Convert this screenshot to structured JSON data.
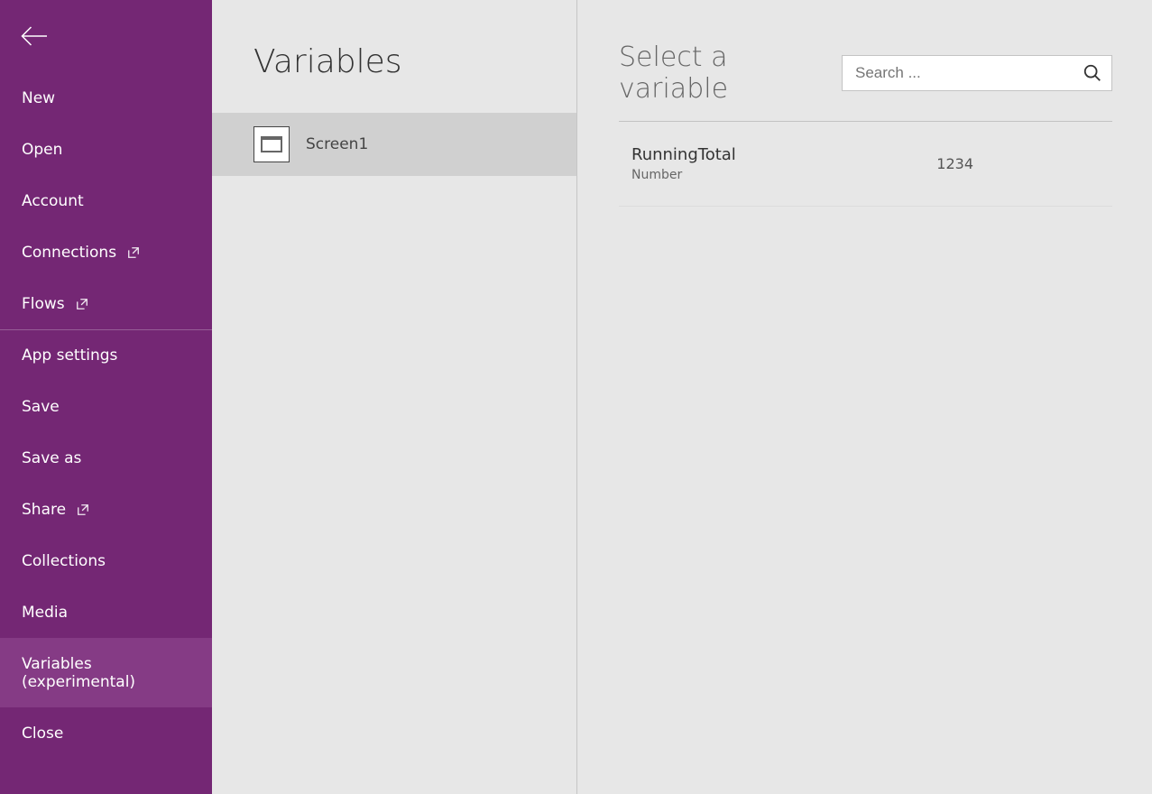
{
  "sidebar": {
    "items": [
      {
        "label": "New",
        "external": false
      },
      {
        "label": "Open",
        "external": false
      },
      {
        "label": "Account",
        "external": false
      },
      {
        "label": "Connections",
        "external": true
      },
      {
        "label": "Flows",
        "external": true
      },
      {
        "label": "App settings",
        "external": false
      },
      {
        "label": "Save",
        "external": false
      },
      {
        "label": "Save as",
        "external": false
      },
      {
        "label": "Share",
        "external": true
      },
      {
        "label": "Collections",
        "external": false
      },
      {
        "label": "Media",
        "external": false
      },
      {
        "label": "Variables (experimental)",
        "external": false
      },
      {
        "label": "Close",
        "external": false
      }
    ]
  },
  "page_title": "Variables",
  "screens": {
    "items": [
      {
        "label": "Screen1"
      }
    ]
  },
  "detail": {
    "heading": "Select a variable",
    "search_placeholder": "Search ...",
    "variables": [
      {
        "name": "RunningTotal",
        "type": "Number",
        "value": "1234"
      }
    ]
  }
}
